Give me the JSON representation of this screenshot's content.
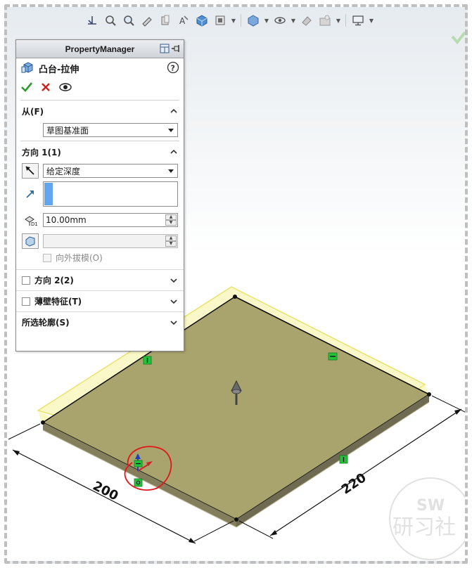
{
  "property_manager": {
    "header_title": "PropertyManager",
    "feature_title": "凸台-拉伸",
    "from_section": {
      "label": "从(F)",
      "start_condition": "草图基准面"
    },
    "direction1_section": {
      "label": "方向 1(1)",
      "end_condition": "给定深度",
      "depth_value": "10.00mm",
      "draft_outward_label": "向外拔模(O)"
    },
    "direction2_label": "方向 2(2)",
    "thin_feature_label": "薄壁特征(T)",
    "selected_contours_label": "所选轮廓(S)"
  },
  "dimensions": {
    "width": "200",
    "depth": "220"
  },
  "watermark": {
    "top": "SW",
    "bottom": "研习社"
  },
  "colors": {
    "plate_top": "#a9a46e",
    "plate_preview": "#f4f29a",
    "relation_badge": "#22c33b",
    "annotation": "#e0161b"
  }
}
